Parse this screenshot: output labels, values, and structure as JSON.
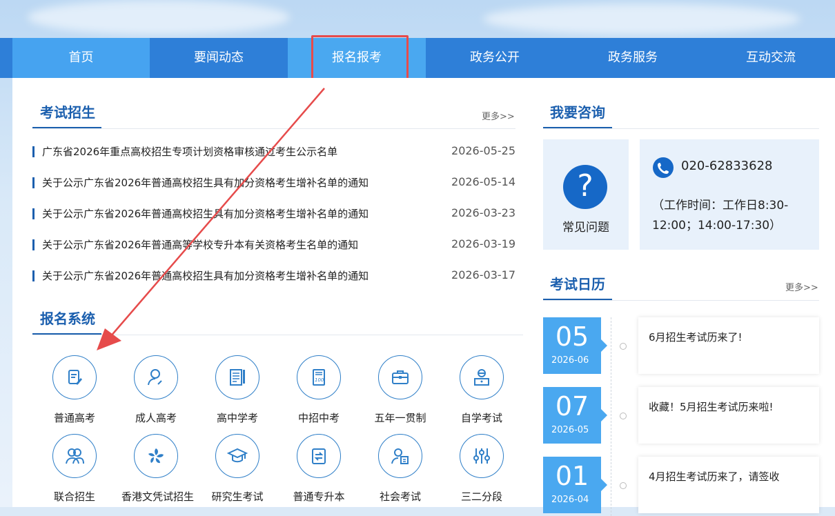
{
  "nav": {
    "items": [
      "首页",
      "要闻动态",
      "报名报考",
      "政务公开",
      "政务服务",
      "互动交流"
    ]
  },
  "exam": {
    "title": "考试招生",
    "more": "更多>>",
    "news": [
      {
        "title": "广东省2026年重点高校招生专项计划资格审核通过考生公示名单",
        "date": "2026-05-25"
      },
      {
        "title": "关于公示广东省2026年普通高校招生具有加分资格考生增补名单的通知",
        "date": "2026-05-14"
      },
      {
        "title": "关于公示广东省2026年普通高校招生具有加分资格考生增补名单的通知",
        "date": "2026-03-23"
      },
      {
        "title": "关于公示广东省2026年普通高等学校专升本有关资格考生名单的通知",
        "date": "2026-03-19"
      },
      {
        "title": "关于公示广东省2026年普通高校招生具有加分资格考生增补名单的通知",
        "date": "2026-03-17"
      }
    ]
  },
  "signup": {
    "title": "报名系统",
    "items": [
      {
        "label": "普通高考",
        "icon": "edit-document-icon"
      },
      {
        "label": "成人高考",
        "icon": "adult-user-icon"
      },
      {
        "label": "高中学考",
        "icon": "notebook-icon"
      },
      {
        "label": "中招中考",
        "icon": "score-sheet-icon"
      },
      {
        "label": "五年一贯制",
        "icon": "briefcase-icon"
      },
      {
        "label": "自学考试",
        "icon": "self-study-user-icon"
      },
      {
        "label": "联合招生",
        "icon": "group-users-icon"
      },
      {
        "label": "香港文凭试招生",
        "icon": "hk-bauhinia-icon"
      },
      {
        "label": "研究生考试",
        "icon": "graduation-cap-icon"
      },
      {
        "label": "普通专升本",
        "icon": "upgrade-document-icon"
      },
      {
        "label": "社会考试",
        "icon": "social-exam-icon"
      },
      {
        "label": "三二分段",
        "icon": "sliders-icon"
      }
    ]
  },
  "consult": {
    "title": "我要咨询",
    "faq_label": "常见问题",
    "phone": "020-62833628",
    "hours": "（工作时间：工作日8:30-12:00；14:00-17:30）"
  },
  "calendar": {
    "title": "考试日历",
    "more": "更多>>",
    "events": [
      {
        "day": "05",
        "ym": "2026-06",
        "text": "6月招生考试历来了!"
      },
      {
        "day": "07",
        "ym": "2026-05",
        "text": "收藏！5月招生考试历来啦!"
      },
      {
        "day": "01",
        "ym": "2026-04",
        "text": "4月招生考试历来了，请签收"
      }
    ]
  },
  "colors": {
    "nav": "#2e7fd8",
    "nav_active": "#4aa8f0",
    "accent": "#1b5fae",
    "highlight": "#e64b4b"
  }
}
